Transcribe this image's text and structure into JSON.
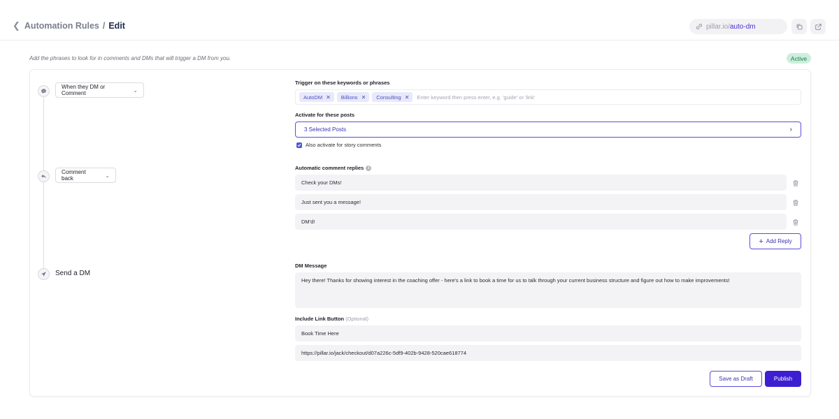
{
  "header": {
    "breadcrumb_parent": "Automation Rules",
    "breadcrumb_sep": "/",
    "breadcrumb_current": "Edit",
    "url_host": "pillar.io/",
    "url_slug": "auto-dm",
    "copy_icon": "copy-icon",
    "external_icon": "external-link-icon"
  },
  "subheader": {
    "description": "Add the phrases to look for in comments and DMs that will trigger a DM from you.",
    "status": "Active"
  },
  "steps": [
    {
      "icon": "message-icon",
      "label": "When they DM or Comment"
    },
    {
      "icon": "reply-icon",
      "label": "Comment back"
    },
    {
      "icon": "send-icon",
      "label": "Send a DM"
    }
  ],
  "trigger": {
    "label": "Trigger on these keywords or phrases",
    "keywords": [
      "AutoDM",
      "Billions",
      "Consulting"
    ],
    "placeholder": "Enter keyword then press enter, e.g. 'guide' or 'link'"
  },
  "posts": {
    "label": "Activate for these posts",
    "selected": "3 Selected Posts",
    "story_checkbox": "Also activate for story comments"
  },
  "replies": {
    "label": "Automatic comment replies",
    "items": [
      "Check your DMs!",
      "Just sent you a message!",
      "DM'd!"
    ],
    "add_label": "Add Reply"
  },
  "dm": {
    "label": "DM Message",
    "message": "Hey there! Thanks for showing interest in the coaching offer - here's a link to book a time for us to talk through your current business structure and figure out how to make improvements!"
  },
  "link_button": {
    "label": "Include Link Button",
    "optional": "(Optional)",
    "button_text": "Book Time Here",
    "url": "https://pillar.io/jack/checkout/d07a226c-5df9-402b-9428-520cae618774"
  },
  "actions": {
    "draft": "Save as Draft",
    "publish": "Publish"
  },
  "colors": {
    "accent": "#3d1fd1",
    "status_bg": "#cdeedd",
    "status_text": "#1c7a4a"
  }
}
